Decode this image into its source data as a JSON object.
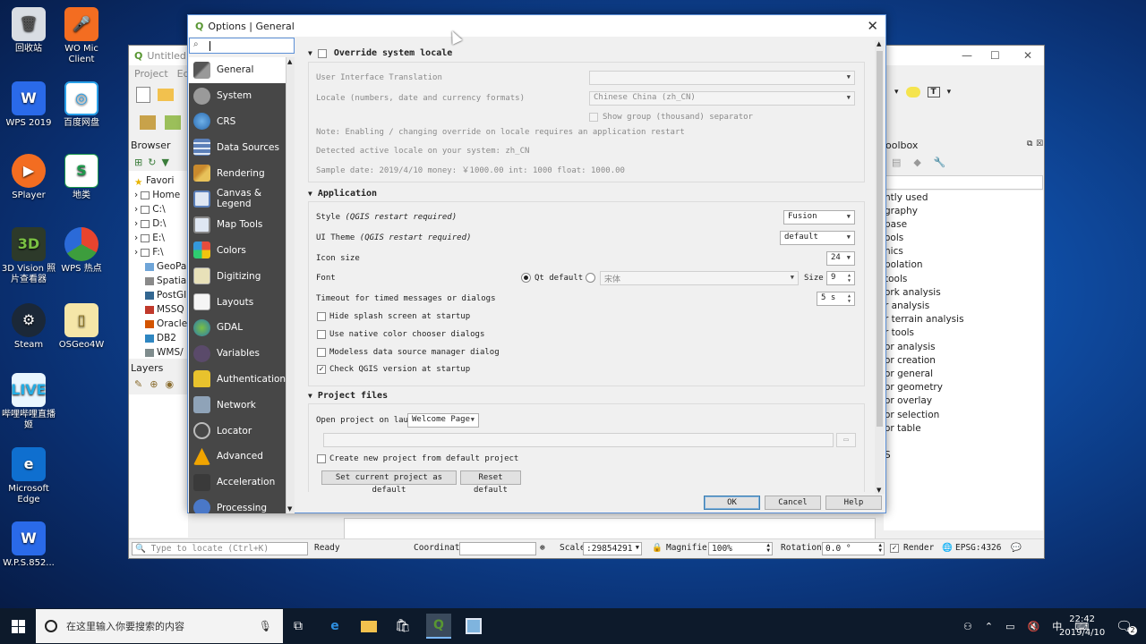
{
  "desktop": {
    "icons": [
      {
        "label": "回收站",
        "icon": "recycle-bin-icon"
      },
      {
        "label": "WO Mic Client",
        "icon": "microphone-icon"
      },
      {
        "label": "WPS 2019",
        "icon": "wps-icon"
      },
      {
        "label": "百度网盘",
        "icon": "baidu-netdisk-icon"
      },
      {
        "label": "SPlayer",
        "icon": "splayer-icon"
      },
      {
        "label": "地类",
        "icon": "spreadsheet-icon"
      },
      {
        "label": "3D Vision 照片查看器",
        "icon": "3d-vision-icon"
      },
      {
        "label": "WPS 热点",
        "icon": "wps-hotspot-icon"
      },
      {
        "label": "Steam",
        "icon": "steam-icon"
      },
      {
        "label": "OSGeo4W",
        "icon": "folder-icon"
      },
      {
        "label": "哔哩哔哩直播姬",
        "icon": "bilibili-icon"
      },
      {
        "label": "Microsoft Edge",
        "icon": "edge-icon"
      },
      {
        "label": "W.P.S.852...",
        "icon": "wps-icon"
      }
    ]
  },
  "qgis": {
    "title": "Untitled P",
    "menu": [
      "Project",
      "Edi"
    ],
    "browser_title": "Browser",
    "browser_items": [
      "Favori",
      "Home",
      "C:\\",
      "D:\\",
      "E:\\",
      "F:\\",
      "GeoPa",
      "Spatia",
      "PostGI",
      "MSSQ",
      "Oracle",
      "DB2",
      "WMS/"
    ],
    "layers_title": "Layers",
    "toolbox_title": "oolbox",
    "toolbox_items": [
      "ntly used",
      "graphy",
      "base",
      "ools",
      "hics",
      "polation",
      "tools",
      "ork analysis",
      "r analysis",
      "r terrain analysis",
      "r tools",
      "or analysis",
      "or creation",
      "or general",
      "or geometry",
      "or overlay",
      "or selection",
      "or table",
      "S"
    ],
    "status": {
      "locate_placeholder": "Type to locate (Ctrl+K)",
      "ready": "Ready",
      "coordinate_label": "Coordinate",
      "coordinate_value": "",
      "scale_label": "Scale",
      "scale_value": ":29854291",
      "magnifier_label": "Magnifier",
      "magnifier_value": "100%",
      "rotation_label": "Rotation",
      "rotation_value": "0.0 °",
      "render_label": "Render",
      "render_checked": true,
      "crs": "EPSG:4326"
    }
  },
  "options": {
    "title": "Options | General",
    "search_value": "",
    "categories": [
      {
        "label": "General",
        "icon": "wrench-icon",
        "active": true
      },
      {
        "label": "System",
        "icon": "gear-icon",
        "active": false
      },
      {
        "label": "CRS",
        "icon": "globe-icon",
        "active": false
      },
      {
        "label": "Data Sources",
        "icon": "table-icon",
        "active": false
      },
      {
        "label": "Rendering",
        "icon": "paintbrush-icon",
        "active": false
      },
      {
        "label": "Canvas & Legend",
        "icon": "canvas-icon",
        "active": false
      },
      {
        "label": "Map Tools",
        "icon": "map-tools-icon",
        "active": false
      },
      {
        "label": "Colors",
        "icon": "colors-icon",
        "active": false
      },
      {
        "label": "Digitizing",
        "icon": "digitizing-icon",
        "active": false
      },
      {
        "label": "Layouts",
        "icon": "layouts-icon",
        "active": false
      },
      {
        "label": "GDAL",
        "icon": "gdal-icon",
        "active": false
      },
      {
        "label": "Variables",
        "icon": "variables-icon",
        "active": false
      },
      {
        "label": "Authentication",
        "icon": "lock-icon",
        "active": false
      },
      {
        "label": "Network",
        "icon": "network-icon",
        "active": false
      },
      {
        "label": "Locator",
        "icon": "search-icon",
        "active": false
      },
      {
        "label": "Advanced",
        "icon": "warning-icon",
        "active": false
      },
      {
        "label": "Acceleration",
        "icon": "acceleration-icon",
        "active": false
      },
      {
        "label": "Processing",
        "icon": "processing-icon",
        "active": false
      }
    ],
    "locale": {
      "header": "Override system locale",
      "override_checked": false,
      "ui_translation_label": "User Interface Translation",
      "ui_translation_value": "",
      "locale_label": "Locale (numbers, date and currency formats)",
      "locale_value": "Chinese China (zh_CN)",
      "group_separator_label": "Show group (thousand) separator",
      "note": "Note: Enabling / changing override on locale requires an application restart",
      "detected": "Detected active locale on your system: zh_CN",
      "sample": "Sample date: 2019/4/10 money: ￥1000.00 int: 1000 float: 1000.00"
    },
    "application": {
      "header": "Application",
      "style_label": "Style",
      "style_note": "(QGIS restart required)",
      "style_value": "Fusion",
      "theme_label": "UI Theme",
      "theme_note": "(QGIS restart required)",
      "theme_value": "default",
      "icon_size_label": "Icon size",
      "icon_size_value": "24",
      "font_label": "Font",
      "font_qt_default": "Qt default",
      "font_custom_value": "宋体",
      "font_size_label": "Size",
      "font_size_value": "9",
      "timeout_label": "Timeout for timed messages or dialogs",
      "timeout_value": "5 s",
      "checkboxes": [
        {
          "label": "Hide splash screen at startup",
          "checked": false
        },
        {
          "label": "Use native color chooser dialogs",
          "checked": false
        },
        {
          "label": "Modeless data source manager dialog",
          "checked": false
        },
        {
          "label": "Check QGIS version at startup",
          "checked": true
        }
      ]
    },
    "project": {
      "header": "Project files",
      "open_label": "Open project on launch",
      "open_value": "Welcome Page",
      "path_value": "",
      "create_default_label": "Create new project from default project",
      "set_default_button": "Set current project as default",
      "reset_default_button": "Reset default"
    },
    "buttons": {
      "ok": "OK",
      "cancel": "Cancel",
      "help": "Help"
    }
  },
  "taskbar": {
    "search_placeholder": "在这里输入你要搜索的内容",
    "ime": "中",
    "time": "22:42",
    "date": "2019/4/10",
    "notification_count": "2"
  }
}
